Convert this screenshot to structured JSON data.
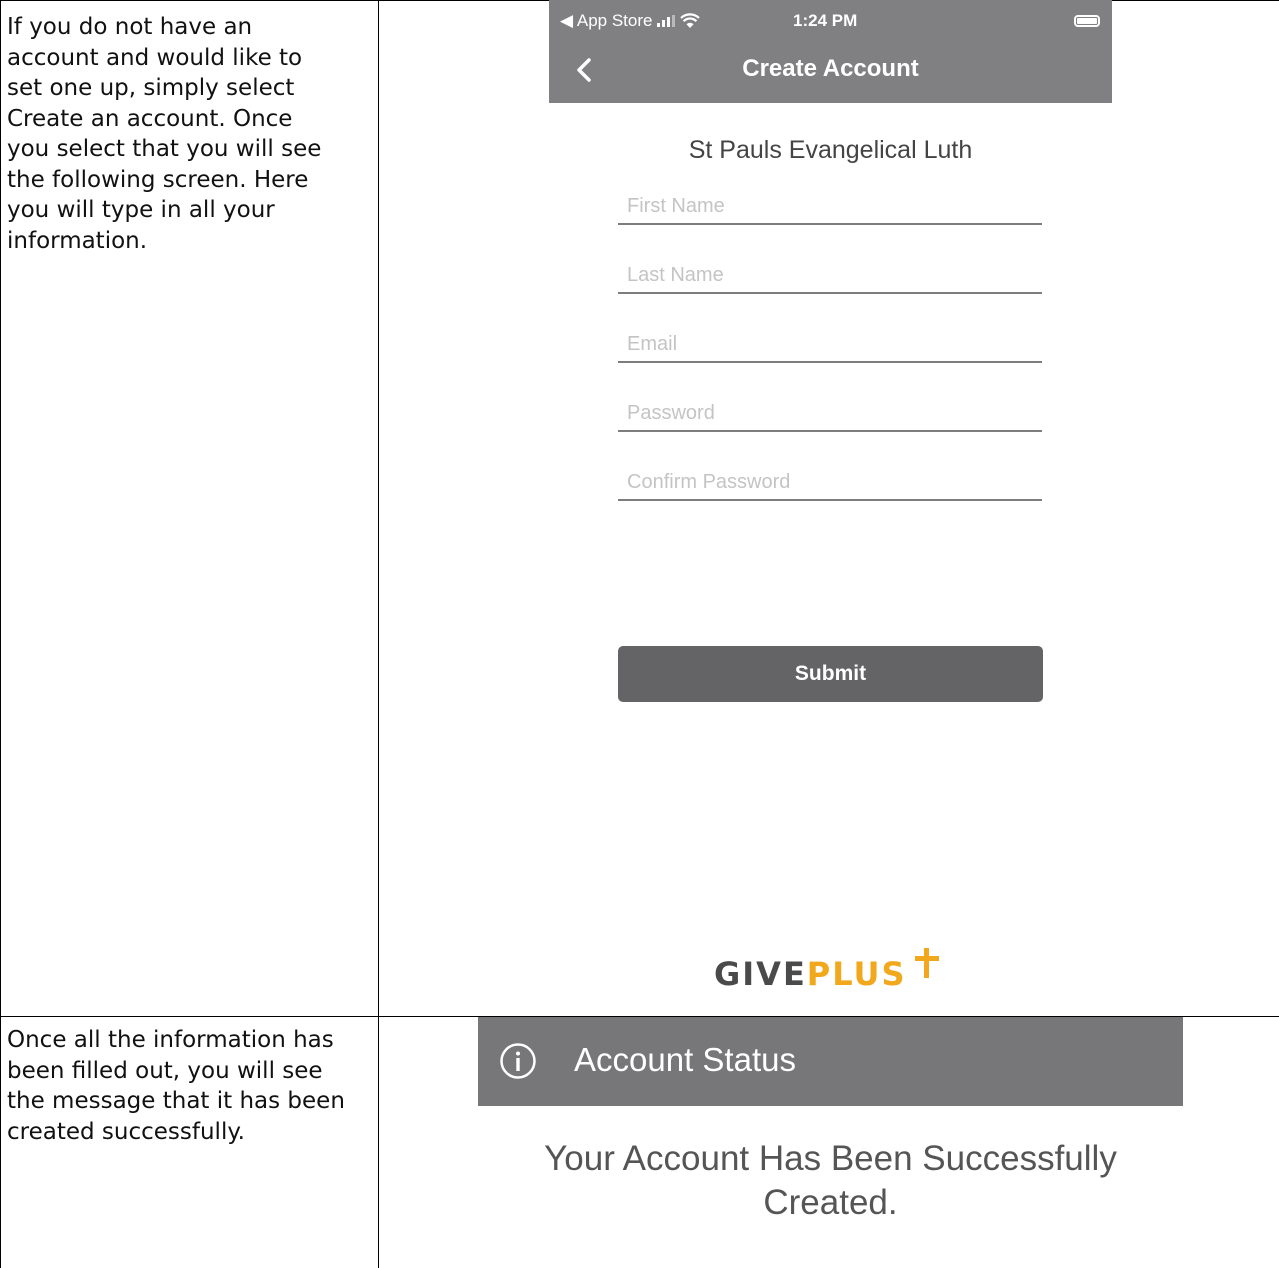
{
  "row1": {
    "instruction": "If you do not have an\naccount and would like to\nset one up, simply select\nCreate an account.  Once\nyou select that you will see\nthe following screen.  Here\nyou will type in all your\ninformation."
  },
  "phone": {
    "status_bar": {
      "back_app": "◀ App Store",
      "time": "1:24 PM"
    },
    "nav": {
      "title": "Create Account"
    },
    "org_name": "St Pauls Evangelical Luth",
    "fields": {
      "first_name": {
        "placeholder": "First Name",
        "value": ""
      },
      "last_name": {
        "placeholder": "Last Name",
        "value": ""
      },
      "email": {
        "placeholder": "Email",
        "value": ""
      },
      "password": {
        "placeholder": "Password",
        "value": ""
      },
      "confirm_password": {
        "placeholder": "Confirm Password",
        "value": ""
      }
    },
    "submit_label": "Submit",
    "logo": {
      "give": "GIVE",
      "plus": "PLUS"
    }
  },
  "row2": {
    "instruction": "Once all the information has\nbeen filled out, you will see\nthe message that it has been\ncreated successfully."
  },
  "account_status": {
    "title": "Account Status",
    "message": "Your Account Has Been Successfully\nCreated."
  },
  "colors": {
    "nav_bg": "#808083",
    "button_bg": "#646466",
    "status_bg": "#777779",
    "logo_accent": "#f2a81d",
    "logo_dark": "#4a4a4a"
  },
  "icons": [
    "chevron-left-icon",
    "signal-icon",
    "wifi-icon",
    "battery-icon",
    "info-icon",
    "cross-icon"
  ]
}
